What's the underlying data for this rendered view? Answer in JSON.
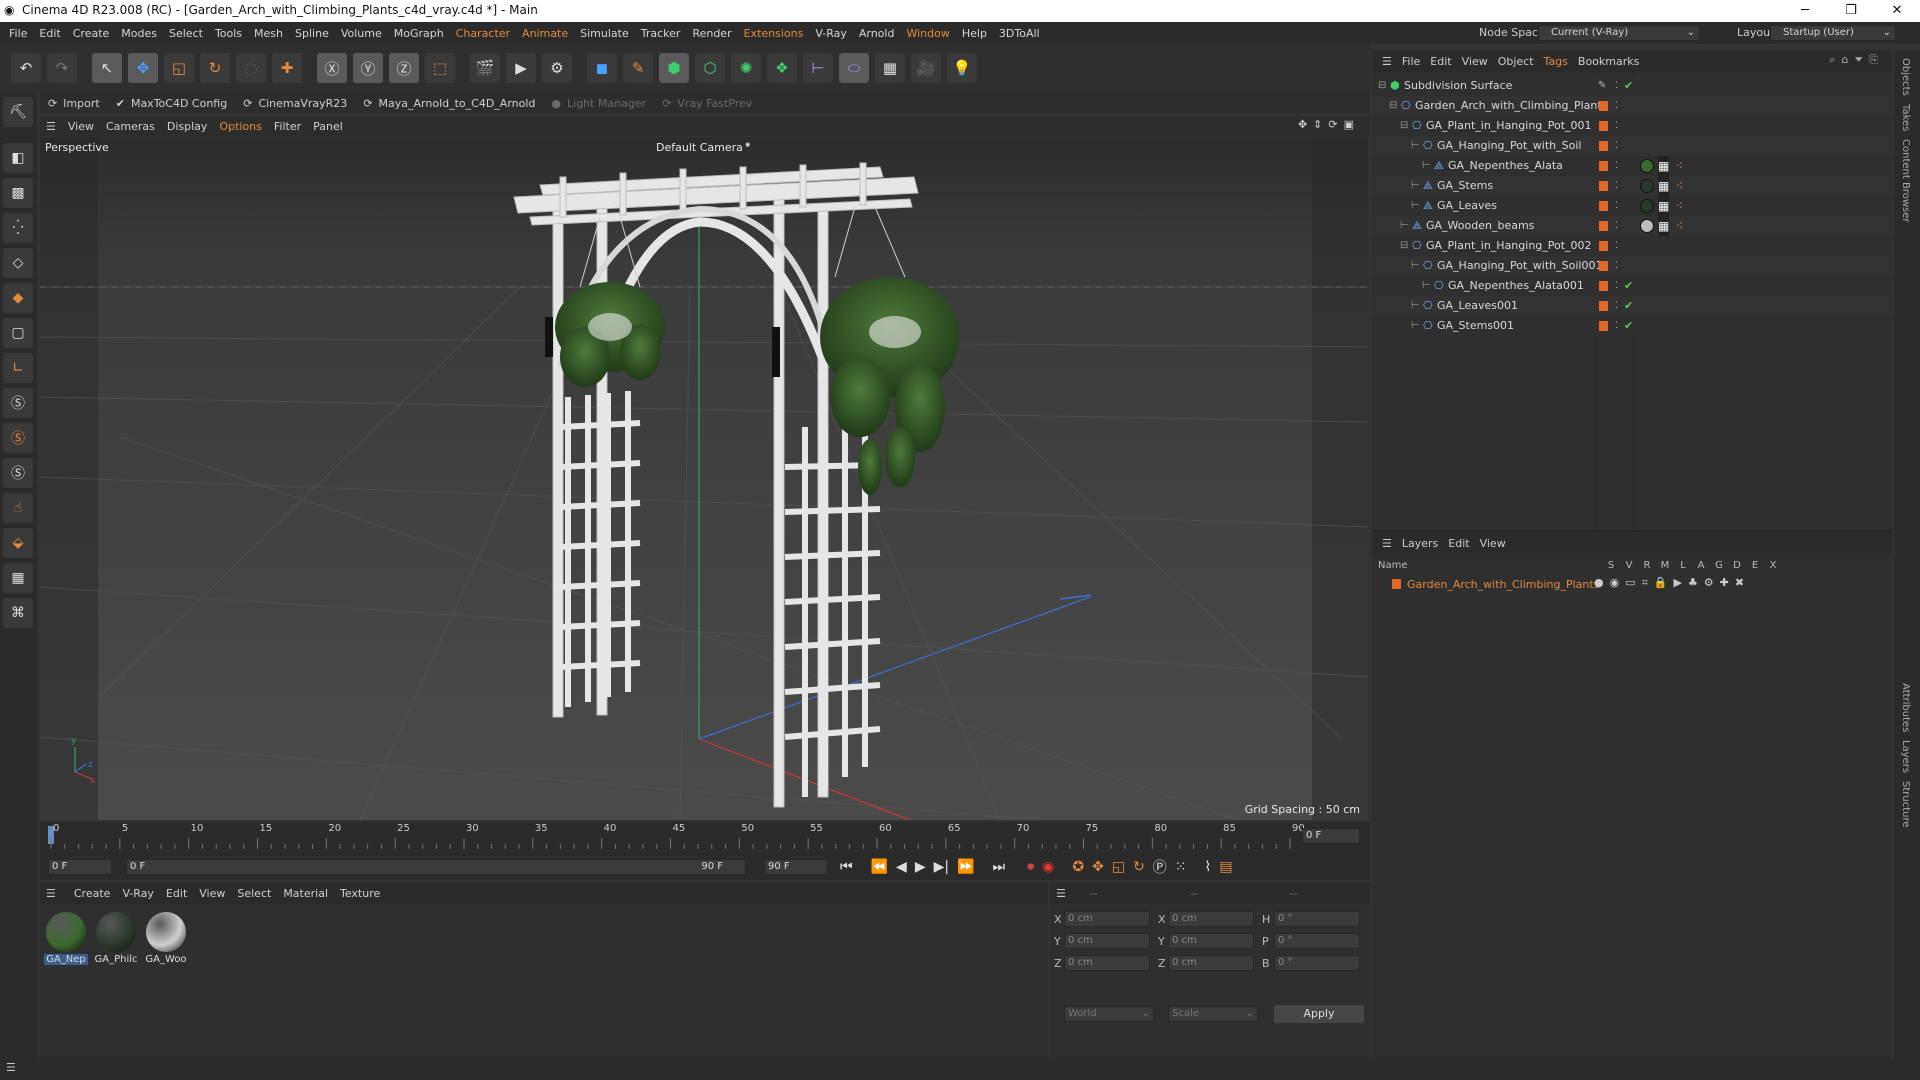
{
  "window": {
    "title": "Cinema 4D R23.008 (RC) - [Garden_Arch_with_Climbing_Plants_c4d_vray.c4d *] - Main",
    "controls": [
      "─",
      "❐",
      "✕"
    ]
  },
  "menubar": {
    "items": [
      "File",
      "Edit",
      "Create",
      "Modes",
      "Select",
      "Tools",
      "Mesh",
      "Spline",
      "Volume",
      "MoGraph",
      "Character",
      "Animate",
      "Simulate",
      "Tracker",
      "Render",
      "Extensions",
      "V-Ray",
      "Arnold",
      "Window",
      "Help",
      "3DToAll"
    ],
    "highlighted": [
      "Character",
      "Animate",
      "Extensions",
      "Window"
    ],
    "node_space_label": "Node Space:",
    "node_space_value": "Current (V-Ray)",
    "layout_label": "Layout:",
    "layout_value": "Startup (User)"
  },
  "plugin_bar": {
    "items": [
      "Import",
      "MaxToC4D Config",
      "CinemaVrayR23",
      "Maya_Arnold_to_C4D_Arnold",
      "Light Manager",
      "Vray FastPrev"
    ]
  },
  "viewport": {
    "menu": [
      "View",
      "Cameras",
      "Display",
      "Options",
      "Filter",
      "Panel"
    ],
    "highlighted": "Options",
    "label": "Perspective",
    "camera": "Default Camera",
    "grid_spacing": "Grid Spacing : 50 cm"
  },
  "timeline": {
    "ticks": [
      "0",
      "5",
      "10",
      "15",
      "20",
      "25",
      "30",
      "35",
      "40",
      "45",
      "50",
      "55",
      "60",
      "65",
      "70",
      "75",
      "80",
      "85",
      "90"
    ],
    "current_frame": "0 F",
    "start_field": "0 F",
    "mid_field": "0 F",
    "end_field_a": "90 F",
    "end_field_b": "90 F"
  },
  "material_panel": {
    "menu": [
      "Create",
      "V-Ray",
      "Edit",
      "View",
      "Select",
      "Material",
      "Texture"
    ],
    "materials": [
      {
        "name": "GA_Nep",
        "color": "#3b6a2e"
      },
      {
        "name": "GA_Philc",
        "color": "#2a3a2a"
      },
      {
        "name": "GA_Woo",
        "color": "#cfcfcf"
      }
    ]
  },
  "coord_panel": {
    "header": [
      "--",
      "--",
      "--"
    ],
    "rows": [
      {
        "a": "X",
        "av": "0 cm",
        "b": "X",
        "bv": "0 cm",
        "c": "H",
        "cv": "0 °"
      },
      {
        "a": "Y",
        "av": "0 cm",
        "b": "Y",
        "bv": "0 cm",
        "c": "P",
        "cv": "0 °"
      },
      {
        "a": "Z",
        "av": "0 cm",
        "b": "Z",
        "bv": "0 cm",
        "c": "B",
        "cv": "0 °"
      }
    ],
    "world": "World",
    "scale": "Scale",
    "apply": "Apply"
  },
  "object_manager": {
    "menu": [
      "File",
      "Edit",
      "View",
      "Object",
      "Tags",
      "Bookmarks"
    ],
    "highlighted": "Tags",
    "objects": [
      {
        "name": "Subdivision Surface",
        "depth": 0,
        "check": true,
        "square": false,
        "tags": 0
      },
      {
        "name": "Garden_Arch_with_Climbing_Plants",
        "depth": 1,
        "check": false,
        "square": true,
        "tags": 0
      },
      {
        "name": "GA_Plant_in_Hanging_Pot_001",
        "depth": 2,
        "check": false,
        "square": true,
        "tags": 0
      },
      {
        "name": "GA_Hanging_Pot_with_Soil",
        "depth": 3,
        "check": false,
        "square": true,
        "tags": 0
      },
      {
        "name": "GA_Nepenthes_Alata",
        "depth": 4,
        "check": false,
        "square": true,
        "tags": 3,
        "mat": "#3b6a2e"
      },
      {
        "name": "GA_Stems",
        "depth": 3,
        "check": false,
        "square": true,
        "tags": 3,
        "mat": "#2a3a2a"
      },
      {
        "name": "GA_Leaves",
        "depth": 3,
        "check": false,
        "square": true,
        "tags": 3,
        "mat": "#2a3a2a"
      },
      {
        "name": "GA_Wooden_beams",
        "depth": 2,
        "check": false,
        "square": true,
        "tags": 3,
        "mat": "#bdbdbd"
      },
      {
        "name": "GA_Plant_in_Hanging_Pot_002",
        "depth": 2,
        "check": false,
        "square": true,
        "tags": 0
      },
      {
        "name": "GA_Hanging_Pot_with_Soil001",
        "depth": 3,
        "check": false,
        "square": true,
        "tags": 0
      },
      {
        "name": "GA_Nepenthes_Alata001",
        "depth": 4,
        "check": true,
        "square": true,
        "tags": 0
      },
      {
        "name": "GA_Leaves001",
        "depth": 3,
        "check": true,
        "square": true,
        "tags": 0
      },
      {
        "name": "GA_Stems001",
        "depth": 3,
        "check": true,
        "square": true,
        "tags": 0
      }
    ]
  },
  "layers": {
    "menu": [
      "Layers",
      "Edit",
      "View"
    ],
    "columns": [
      "Name",
      "S",
      "V",
      "R",
      "M",
      "L",
      "A",
      "G",
      "D",
      "E",
      "X"
    ],
    "items": [
      {
        "name": "Garden_Arch_with_Climbing_Plants"
      }
    ]
  },
  "vertical_tabs": [
    "Objects",
    "Takes",
    "Content Browser",
    "Attributes",
    "Layers",
    "Structure"
  ],
  "colors": {
    "accent": "#e58a3a",
    "bg": "#333333"
  }
}
